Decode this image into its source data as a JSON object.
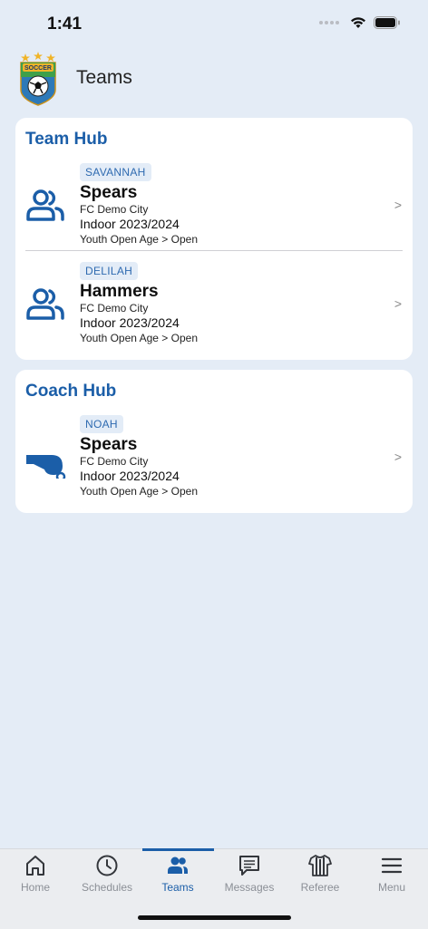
{
  "status": {
    "time": "1:41"
  },
  "header": {
    "title": "Teams",
    "logo_text": "SOCCER"
  },
  "team_hub": {
    "title": "Team Hub",
    "teams": [
      {
        "badge": "SAVANNAH",
        "name": "Spears",
        "club": "FC Demo City",
        "season": "Indoor 2023/2024",
        "division": "Youth Open Age > Open",
        "chevron": ">"
      },
      {
        "badge": "DELILAH",
        "name": "Hammers",
        "club": "FC Demo City",
        "season": "Indoor 2023/2024",
        "division": "Youth Open Age > Open",
        "chevron": ">"
      }
    ]
  },
  "coach_hub": {
    "title": "Coach Hub",
    "teams": [
      {
        "badge": "NOAH",
        "name": "Spears",
        "club": "FC Demo City",
        "season": "Indoor 2023/2024",
        "division": "Youth Open Age > Open",
        "chevron": ">"
      }
    ]
  },
  "tabs": [
    {
      "label": "Home",
      "icon": "home-icon"
    },
    {
      "label": "Schedules",
      "icon": "clock-icon"
    },
    {
      "label": "Teams",
      "icon": "people-icon",
      "active": true
    },
    {
      "label": "Messages",
      "icon": "message-icon"
    },
    {
      "label": "Referee",
      "icon": "referee-shirt-icon"
    },
    {
      "label": "Menu",
      "icon": "hamburger-icon"
    }
  ],
  "colors": {
    "accent": "#1b5ea8",
    "background": "#e4ecf6",
    "card": "#ffffff",
    "badge_bg": "#e3ecf7"
  }
}
